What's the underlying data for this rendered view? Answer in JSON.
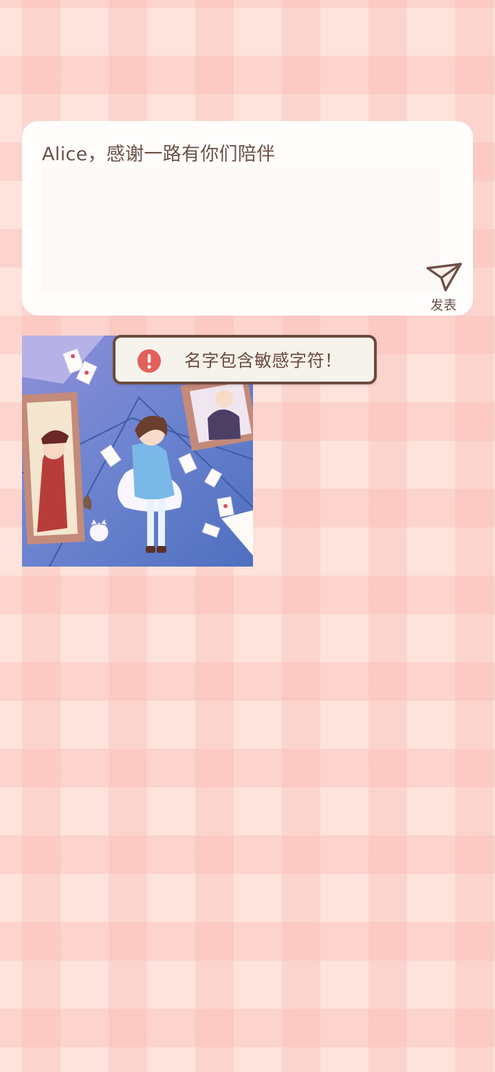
{
  "composer": {
    "text": "Alice，感谢一路有你们陪伴",
    "post_label": "发表",
    "send_icon": "paper-plane-icon"
  },
  "image": {
    "icon": "alice-illustration"
  },
  "toast": {
    "message": "名字包含敏感字符！",
    "icon": "alert-icon"
  },
  "colors": {
    "background": "#fde3dc",
    "text": "#6c5148",
    "toast_border": "#6a4a3d",
    "alert": "#e2615a"
  }
}
